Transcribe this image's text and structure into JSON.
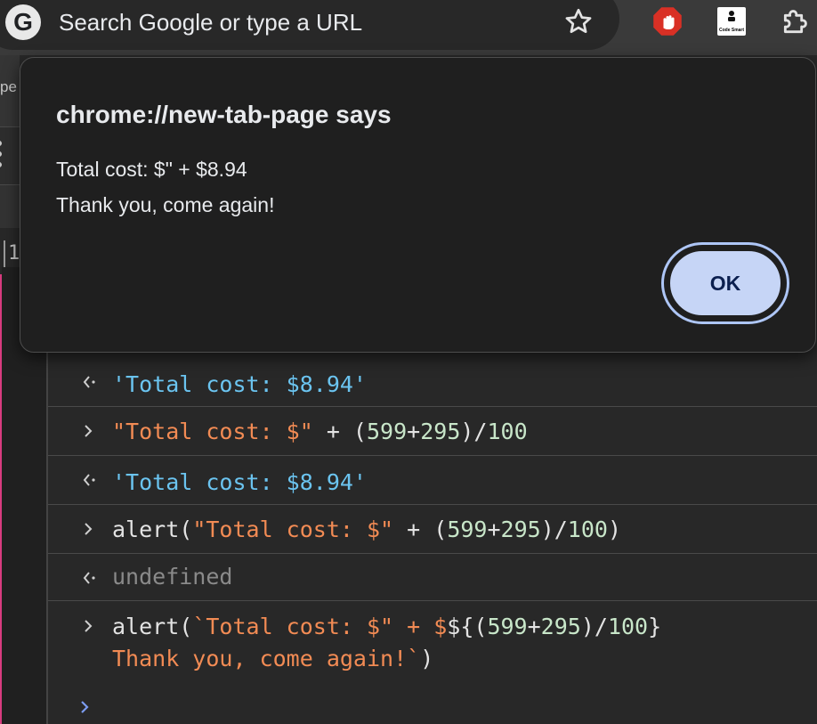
{
  "browser": {
    "omnibox_placeholder": "Search Google or type a URL",
    "google_logo_letter": "G",
    "icons": [
      "google-g-icon",
      "star-icon",
      "adblock-hand-icon",
      "code-smart-extension-icon",
      "extensions-puzzle-icon"
    ],
    "code_smart_label": "Code Smart"
  },
  "left_fragments": {
    "tab_text": "pe",
    "digit_text": "1"
  },
  "dialog": {
    "title": "chrome://new-tab-page says",
    "message_line_1": "Total cost: $\" + $8.94",
    "message_line_2": "Thank you, come again!",
    "ok_label": "OK"
  },
  "console": {
    "rows": [
      {
        "kind": "result",
        "text": "'Total cost: $8.94'"
      },
      {
        "kind": "input",
        "parts": [
          "\"Total cost: $\"",
          " + (",
          "599",
          "+",
          "295",
          ")/",
          "100"
        ]
      },
      {
        "kind": "result",
        "text": "'Total cost: $8.94'"
      },
      {
        "kind": "input",
        "parts": [
          "alert(",
          "\"Total cost: $\"",
          " + (",
          "599",
          "+",
          "295",
          ")/",
          "100",
          ")"
        ]
      },
      {
        "kind": "result",
        "text": "undefined"
      },
      {
        "kind": "input",
        "parts": [
          "alert(",
          "`Total cost: $\" + $",
          "${(",
          "599",
          "+",
          "295",
          ")/",
          "100",
          "}"
        ],
        "line2": [
          "Thank you, come again!`",
          ")"
        ]
      }
    ]
  },
  "colors": {
    "string": "#f28b54",
    "result_string": "#6bc4f0",
    "number": "#c8e6c9",
    "undefined": "#8a8a8a",
    "ok_button": "#c6d5f6",
    "dialog_bg": "#1f1f1f"
  }
}
